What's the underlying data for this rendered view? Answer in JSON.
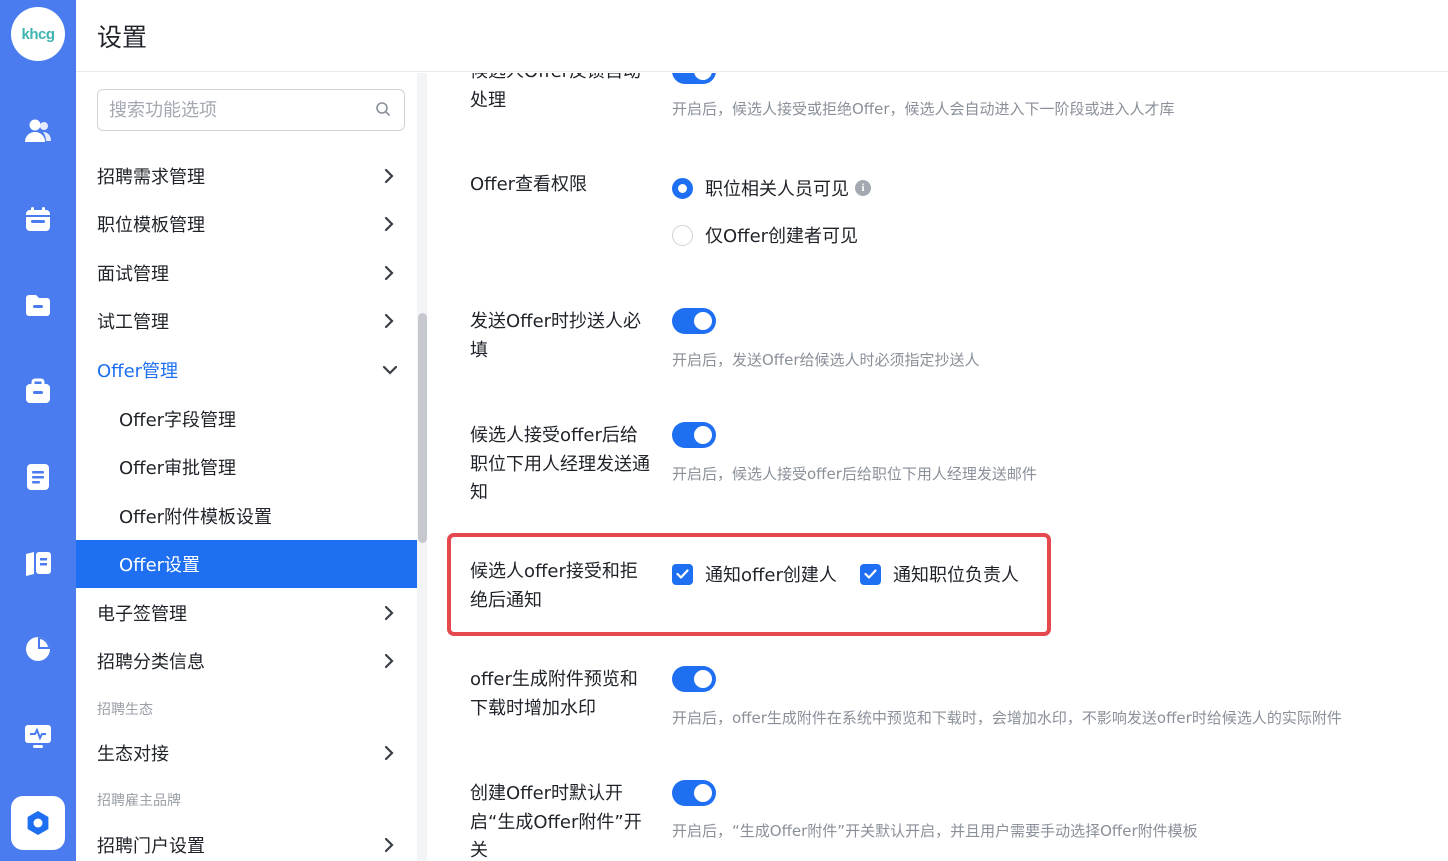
{
  "logo": {
    "text": "khcg"
  },
  "header": {
    "title": "设置"
  },
  "search": {
    "placeholder": "搜索功能选项"
  },
  "sidebar": {
    "items": [
      {
        "label": "招聘需求管理"
      },
      {
        "label": "职位模板管理"
      },
      {
        "label": "面试管理"
      },
      {
        "label": "试工管理"
      },
      {
        "label": "Offer管理"
      },
      {
        "label": "Offer字段管理"
      },
      {
        "label": "Offer审批管理"
      },
      {
        "label": "Offer附件模板设置"
      },
      {
        "label": "Offer设置"
      },
      {
        "label": "电子签管理"
      },
      {
        "label": "招聘分类信息"
      },
      {
        "label": "生态对接"
      },
      {
        "label": "招聘门户设置"
      }
    ],
    "groups": [
      "招聘生态",
      "招聘雇主品牌"
    ]
  },
  "settings": {
    "s0": {
      "label": "候选人Offer反馈自动处理",
      "desc": "开启后，候选人接受或拒绝Offer，候选人会自动进入下一阶段或进入人才库",
      "enabled": true
    },
    "s1": {
      "label": "Offer查看权限",
      "options": [
        "职位相关人员可见",
        "仅Offer创建者可见"
      ],
      "selected": "职位相关人员可见"
    },
    "s2": {
      "label": "发送Offer时抄送人必填",
      "desc": "开启后，发送Offer给候选人时必须指定抄送人",
      "enabled": true
    },
    "s3": {
      "label": "候选人接受offer后给职位下用人经理发送通知",
      "desc": "开启后，候选人接受offer后给职位下用人经理发送邮件",
      "enabled": true
    },
    "s4": {
      "label": "候选人offer接受和拒绝后通知",
      "checks": [
        "通知offer创建人",
        "通知职位负责人"
      ],
      "checked": [
        true,
        true
      ]
    },
    "s5": {
      "label": "offer生成附件预览和下载时增加水印",
      "desc": "开启后，offer生成附件在系统中预览和下载时，会增加水印，不影响发送offer时给候选人的实际附件",
      "enabled": true
    },
    "s6": {
      "label": "创建Offer时默认开启“生成Offer附件”开关",
      "desc": "开启后，“生成Offer附件”开关默认开启，并且用户需要手动选择Offer附件模板",
      "enabled": true
    }
  },
  "colors": {
    "rail": "#4a7cf0",
    "accent": "#1e6ff2",
    "highlight": "#e5484d"
  },
  "icons": {
    "rail": [
      "users-icon",
      "calendar-icon",
      "folder-icon",
      "briefcase-icon",
      "document-icon",
      "book-icon",
      "pie-chart-icon",
      "monitor-icon",
      "settings-icon"
    ]
  }
}
